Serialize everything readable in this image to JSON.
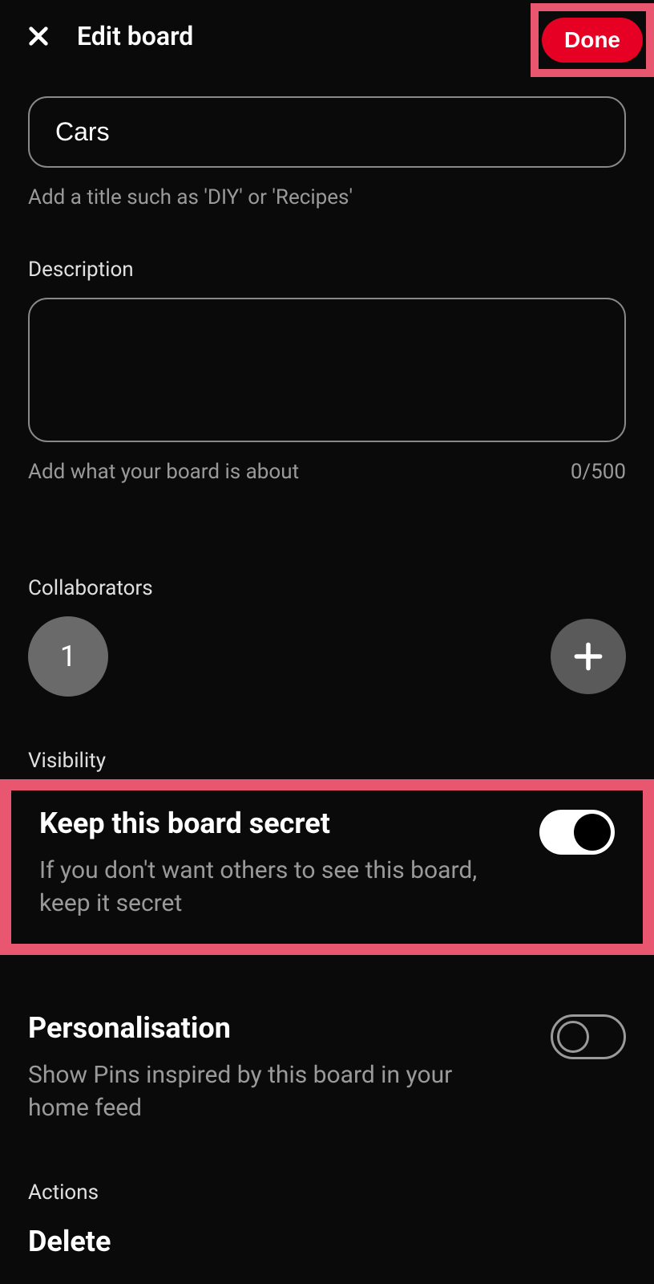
{
  "header": {
    "title": "Edit board",
    "done_label": "Done"
  },
  "title_field": {
    "value": "Cars",
    "helper": "Add a title such as 'DIY' or 'Recipes'"
  },
  "description": {
    "label": "Description",
    "value": "",
    "helper": "Add what your board is about",
    "counter": "0/500"
  },
  "collaborators": {
    "label": "Collaborators",
    "count": "1"
  },
  "visibility": {
    "label": "Visibility",
    "secret_title": "Keep this board secret",
    "secret_desc": "If you don't want others to see this board, keep it secret",
    "secret_on": true
  },
  "personalisation": {
    "title": "Personalisation",
    "desc": "Show Pins inspired by this board in your home feed",
    "on": false
  },
  "actions": {
    "label": "Actions",
    "delete_label": "Delete"
  }
}
